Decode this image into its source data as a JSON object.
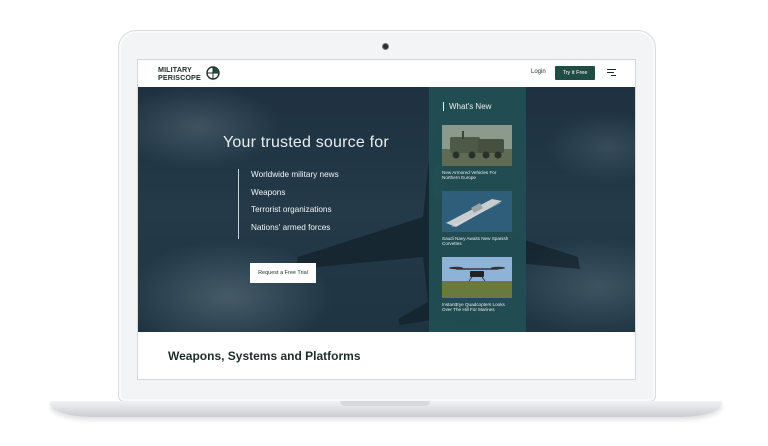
{
  "header": {
    "logo_line1": "MILITARY",
    "logo_line2": "PERISCOPE",
    "login_label": "Login",
    "try_label": "Try it Free",
    "menu_icon": "hamburger-menu-icon"
  },
  "hero": {
    "title": "Your trusted source for",
    "items": [
      "Worldwide military news",
      "Weapons",
      "Terrorist organizations",
      "Nations' armed forces"
    ],
    "cta_label": "Request a Free Trial"
  },
  "whats_new": {
    "heading": "What's New",
    "cards": [
      {
        "caption": "New Armored Vehicles For Northern Europe"
      },
      {
        "caption": "Saudi Navy Awaits New Spanish Corvettes"
      },
      {
        "caption": "InstantEye Quadcopters Looks Over The Hill For Marines"
      }
    ]
  },
  "section": {
    "title": "Weapons, Systems and Platforms"
  },
  "colors": {
    "brand_green": "#1f4d44",
    "panel_teal": "#224e54",
    "hero_navy": "#1d3140"
  }
}
